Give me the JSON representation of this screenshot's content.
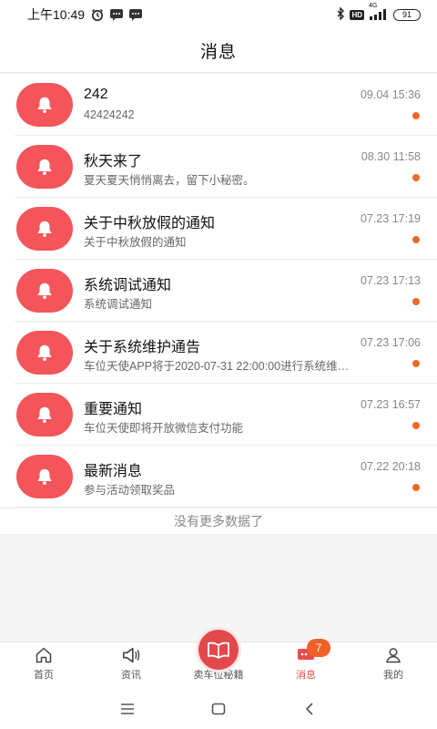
{
  "status_bar": {
    "time": "上午10:49",
    "network_label": "4G",
    "hd_label": "HD",
    "battery": "91"
  },
  "header": {
    "title": "消息"
  },
  "messages": [
    {
      "title": "242",
      "subtitle": "42424242",
      "time": "09.04 15:36",
      "unread": true
    },
    {
      "title": "秋天来了",
      "subtitle": "夏天夏天悄悄离去，留下小秘密。",
      "time": "08.30 11:58",
      "unread": true
    },
    {
      "title": "关于中秋放假的通知",
      "subtitle": "关于中秋放假的通知",
      "time": "07.23 17:19",
      "unread": true
    },
    {
      "title": "系统调试通知",
      "subtitle": "系统调试通知",
      "time": "07.23 17:13",
      "unread": true
    },
    {
      "title": "关于系统维护通告",
      "subtitle": "车位天使APP将于2020-07-31 22:00:00进行系统维…",
      "time": "07.23 17:06",
      "unread": true
    },
    {
      "title": "重要通知",
      "subtitle": "车位天使即将开放微信支付功能",
      "time": "07.23 16:57",
      "unread": true
    },
    {
      "title": "最新消息",
      "subtitle": "参与活动领取奖品",
      "time": "07.22 20:18",
      "unread": true
    }
  ],
  "list_footer": "没有更多数据了",
  "tabbar": {
    "tabs": [
      {
        "label": "首页",
        "icon": "home-icon"
      },
      {
        "label": "资讯",
        "icon": "megaphone-icon"
      },
      {
        "label": "卖车位秘籍",
        "icon": "book-icon"
      },
      {
        "label": "消息",
        "icon": "message-icon",
        "badge": "7",
        "active": true
      },
      {
        "label": "我的",
        "icon": "user-icon"
      }
    ]
  },
  "colors": {
    "accent": "#e84c4f",
    "avatar_bg": "#f3555a",
    "unread_dot": "#ee6a22",
    "badge": "#f0612a"
  }
}
